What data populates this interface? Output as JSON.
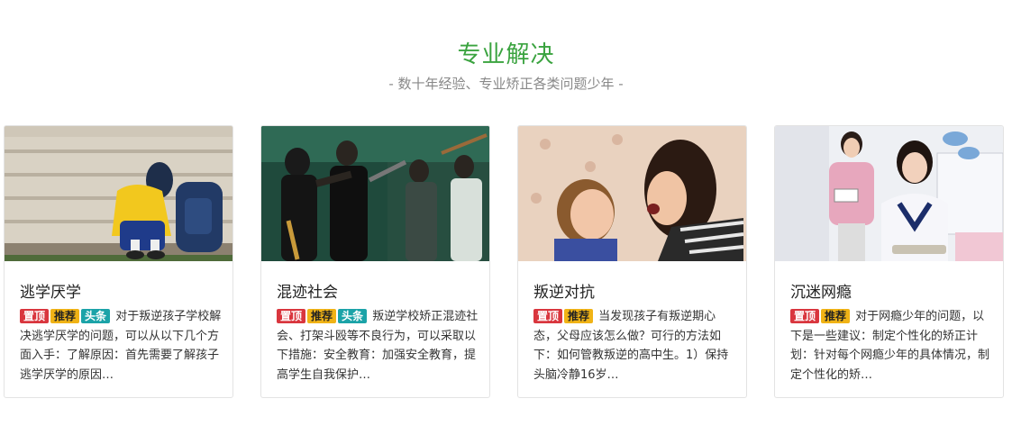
{
  "section": {
    "title": "专业解决",
    "subtitle": "- 数十年经验、专业矫正各类问题少年 -"
  },
  "tags": {
    "top": "置顶",
    "recommend": "推荐",
    "headline": "头条"
  },
  "cards": [
    {
      "title": "逃学厌学",
      "tags": [
        "top",
        "recommend",
        "headline"
      ],
      "description": "对于叛逆孩子学校解决逃学厌学的问题，可以从以下几个方面入手：了解原因：首先需要了解孩子逃学厌学的原因…"
    },
    {
      "title": "混迹社会",
      "tags": [
        "top",
        "recommend",
        "headline"
      ],
      "description": "叛逆学校矫正混迹社会、打架斗殴等不良行为，可以采取以下措施：安全教育：加强安全教育，提高学生自我保护…"
    },
    {
      "title": "叛逆对抗",
      "tags": [
        "top",
        "recommend"
      ],
      "description": "当发现孩子有叛逆期心态，父母应该怎么做？可行的方法如下：如何管教叛逆的高中生。1）保持头脑冷静16岁…"
    },
    {
      "title": "沉迷网瘾",
      "tags": [
        "top",
        "recommend"
      ],
      "description": "对于网瘾少年的问题，以下是一些建议：制定个性化的矫正计划：针对每个网瘾少年的具体情况，制定个性化的矫…"
    }
  ]
}
